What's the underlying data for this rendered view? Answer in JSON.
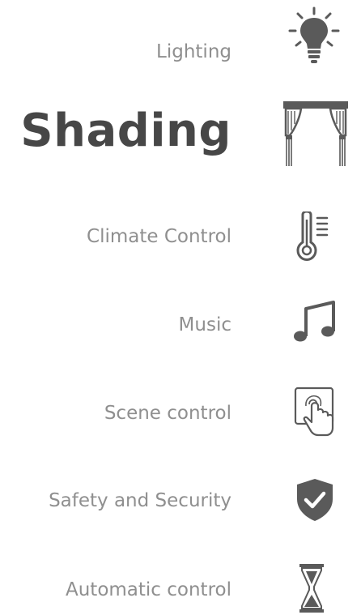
{
  "menu": {
    "items": [
      {
        "label": "Lighting",
        "icon": "lightbulb-icon",
        "active": false
      },
      {
        "label": "Shading",
        "icon": "curtain-icon",
        "active": true
      },
      {
        "label": "Climate Control",
        "icon": "thermometer-icon",
        "active": false
      },
      {
        "label": "Music",
        "icon": "music-note-icon",
        "active": false
      },
      {
        "label": "Scene control",
        "icon": "touch-panel-icon",
        "active": false
      },
      {
        "label": "Safety and Security",
        "icon": "shield-check-icon",
        "active": false
      },
      {
        "label": "Automatic control",
        "icon": "hourglass-icon",
        "active": false
      }
    ]
  },
  "colors": {
    "inactive_text": "#8f8f8f",
    "active_text": "#474747",
    "icon": "#5a5a5a",
    "background": "#ffffff"
  }
}
